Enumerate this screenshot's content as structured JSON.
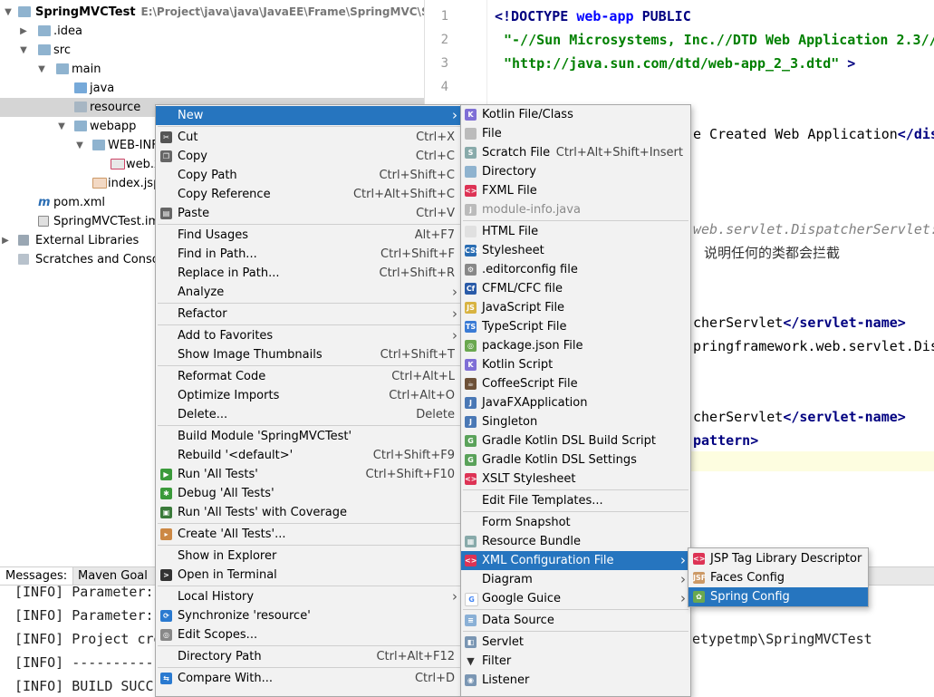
{
  "tree": {
    "project_name": "SpringMVCTest",
    "project_path": "E:\\Project\\java\\java\\JavaEE\\Frame\\SpringMVC\\SpringMV",
    "idea": ".idea",
    "src": "src",
    "main": "main",
    "java": "java",
    "resource": "resource",
    "webapp": "webapp",
    "webinf": "WEB-INF",
    "webxml": "web.x",
    "indexjsp": "index.jsp",
    "pom": "pom.xml",
    "iml": "SpringMVCTest.iml",
    "ext_libs": "External Libraries",
    "scratches": "Scratches and Console"
  },
  "editor": {
    "line_numbers": [
      "1",
      "2",
      "3",
      "4"
    ],
    "doctype_open": "<!DOCTYPE",
    "doctype_name": "web-app",
    "doctype_public": "PUBLIC",
    "doctype_id": "\"-//Sun Microsystems, Inc.//DTD Web Application 2.3//",
    "doctype_url": "\"http://java.sun.com/dtd/web-app_2_3.dtd\"",
    "doctype_close": ">",
    "display_name_text": "e Created Web Application",
    "display_name_close": "</dis",
    "comment_frag": "web.servlet.DispatcherServlet:",
    "chinese_comment": "说明任何的类都会拦截",
    "servlet_name_text_1": "cherServlet",
    "servlet_name_close_1": "</servlet-name>",
    "servlet_class_text": "pringframework.web.servlet.Dis",
    "servlet_name_text_2": "cherServlet",
    "servlet_name_close_2": "</servlet-name>",
    "pattern_frag": "pattern>"
  },
  "bottom": {
    "tabs": [
      "Messages:",
      "Maven Goal"
    ],
    "lines": [
      "[INFO] Parameter:",
      "[INFO] Parameter:",
      "[INFO] Project cre",
      "[INFO] -----------",
      "[INFO] BUILD SUCC"
    ],
    "path_tail": "etypetmp\\SpringMVCTest"
  },
  "context_menu": [
    {
      "label": "New",
      "sub": true,
      "highlighted": true
    },
    {
      "sep": true
    },
    {
      "label": "Cut",
      "shortcut": "Ctrl+X",
      "icon": "scissors-icon"
    },
    {
      "label": "Copy",
      "shortcut": "Ctrl+C",
      "icon": "copy-icon"
    },
    {
      "label": "Copy Path",
      "shortcut": "Ctrl+Shift+C"
    },
    {
      "label": "Copy Reference",
      "shortcut": "Ctrl+Alt+Shift+C"
    },
    {
      "label": "Paste",
      "shortcut": "Ctrl+V",
      "icon": "paste-icon"
    },
    {
      "sep": true
    },
    {
      "label": "Find Usages",
      "shortcut": "Alt+F7"
    },
    {
      "label": "Find in Path...",
      "shortcut": "Ctrl+Shift+F"
    },
    {
      "label": "Replace in Path...",
      "shortcut": "Ctrl+Shift+R"
    },
    {
      "label": "Analyze",
      "sub": true
    },
    {
      "sep": true
    },
    {
      "label": "Refactor",
      "sub": true
    },
    {
      "sep": true
    },
    {
      "label": "Add to Favorites",
      "sub": true
    },
    {
      "label": "Show Image Thumbnails",
      "shortcut": "Ctrl+Shift+T"
    },
    {
      "sep": true
    },
    {
      "label": "Reformat Code",
      "shortcut": "Ctrl+Alt+L"
    },
    {
      "label": "Optimize Imports",
      "shortcut": "Ctrl+Alt+O"
    },
    {
      "label": "Delete...",
      "shortcut": "Delete"
    },
    {
      "sep": true
    },
    {
      "label": "Build Module 'SpringMVCTest'"
    },
    {
      "label": "Rebuild '<default>'",
      "shortcut": "Ctrl+Shift+F9"
    },
    {
      "label": "Run 'All Tests'",
      "shortcut": "Ctrl+Shift+F10",
      "icon": "run-icon"
    },
    {
      "label": "Debug 'All Tests'",
      "icon": "debug-icon"
    },
    {
      "label": "Run 'All Tests' with Coverage",
      "icon": "coverage-icon"
    },
    {
      "sep": true
    },
    {
      "label": "Create 'All Tests'...",
      "icon": "create-test-icon"
    },
    {
      "sep": true
    },
    {
      "label": "Show in Explorer"
    },
    {
      "label": "Open in Terminal",
      "icon": "terminal-icon"
    },
    {
      "sep": true
    },
    {
      "label": "Local History",
      "sub": true
    },
    {
      "label": "Synchronize 'resource'",
      "icon": "sync-icon"
    },
    {
      "label": "Edit Scopes...",
      "icon": "scopes-icon"
    },
    {
      "sep": true
    },
    {
      "label": "Directory Path",
      "shortcut": "Ctrl+Alt+F12"
    },
    {
      "sep": true
    },
    {
      "label": "Compare With...",
      "shortcut": "Ctrl+D",
      "icon": "compare-icon"
    }
  ],
  "new_menu": [
    {
      "label": "Kotlin File/Class",
      "icon": "kotlin-file-icon"
    },
    {
      "label": "File",
      "icon": "file-icon"
    },
    {
      "label": "Scratch File",
      "shortcut": "Ctrl+Alt+Shift+Insert",
      "icon": "scratch-file-icon"
    },
    {
      "label": "Directory",
      "icon": "directory-icon"
    },
    {
      "label": "FXML File",
      "icon": "fxml-file-icon"
    },
    {
      "label": "module-info.java",
      "disabled": true,
      "icon": "module-info-icon"
    },
    {
      "sep": true
    },
    {
      "label": "HTML File",
      "icon": "html-file-icon"
    },
    {
      "label": "Stylesheet",
      "icon": "stylesheet-icon"
    },
    {
      "label": ".editorconfig file",
      "icon": "editorconfig-icon"
    },
    {
      "label": "CFML/CFC file",
      "icon": "cfml-icon"
    },
    {
      "label": "JavaScript File",
      "icon": "javascript-file-icon"
    },
    {
      "label": "TypeScript File",
      "icon": "typescript-file-icon"
    },
    {
      "label": "package.json File",
      "icon": "package-json-icon"
    },
    {
      "label": "Kotlin Script",
      "icon": "kotlin-script-icon"
    },
    {
      "label": "CoffeeScript File",
      "icon": "coffeescript-icon"
    },
    {
      "label": "JavaFXApplication",
      "icon": "javafx-icon"
    },
    {
      "label": "Singleton",
      "icon": "singleton-icon"
    },
    {
      "label": "Gradle Kotlin DSL Build Script",
      "icon": "gradle-icon"
    },
    {
      "label": "Gradle Kotlin DSL Settings",
      "icon": "gradle-icon"
    },
    {
      "label": "XSLT Stylesheet",
      "icon": "xslt-icon"
    },
    {
      "sep": true
    },
    {
      "label": "Edit File Templates..."
    },
    {
      "sep": true
    },
    {
      "label": "Form Snapshot"
    },
    {
      "label": "Resource Bundle",
      "icon": "resource-bundle-icon"
    },
    {
      "label": "XML Configuration File",
      "sub": true,
      "highlighted": true,
      "icon": "xml-config-icon"
    },
    {
      "label": "Diagram",
      "sub": true
    },
    {
      "label": "Google Guice",
      "sub": true,
      "icon": "google-guice-icon"
    },
    {
      "sep": true
    },
    {
      "label": "Data Source",
      "icon": "data-source-icon"
    },
    {
      "sep": true
    },
    {
      "label": "Servlet",
      "icon": "servlet-icon"
    },
    {
      "label": "Filter",
      "icon": "filter-icon"
    },
    {
      "label": "Listener",
      "icon": "listener-icon"
    }
  ],
  "xml_menu": [
    {
      "label": "JSP Tag Library Descriptor",
      "icon": "jsp-tld-icon"
    },
    {
      "label": "Faces Config",
      "icon": "faces-config-icon"
    },
    {
      "label": "Spring Config",
      "highlighted": true,
      "icon": "spring-config-icon"
    }
  ],
  "colors": {
    "highlight": "#2675bf",
    "menu_bg": "#f2f2f2",
    "selection_gray": "#d5d5d5"
  }
}
